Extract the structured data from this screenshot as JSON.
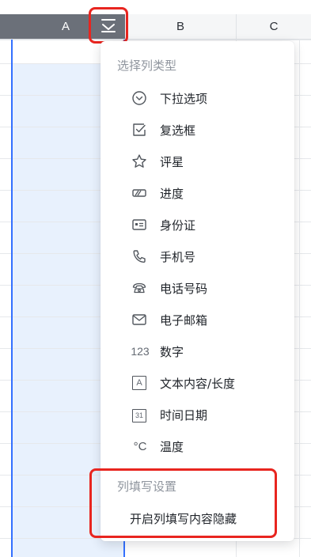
{
  "columns": {
    "a": "A",
    "b": "B",
    "c": "C"
  },
  "menu": {
    "title": "选择列类型",
    "items": [
      {
        "label": "下拉选项",
        "icon": "dropdown-circle-icon"
      },
      {
        "label": "复选框",
        "icon": "checkbox-icon"
      },
      {
        "label": "评星",
        "icon": "star-icon"
      },
      {
        "label": "进度",
        "icon": "progress-icon"
      },
      {
        "label": "身份证",
        "icon": "id-card-icon"
      },
      {
        "label": "手机号",
        "icon": "phone-icon"
      },
      {
        "label": "电话号码",
        "icon": "telephone-icon"
      },
      {
        "label": "电子邮箱",
        "icon": "mail-icon"
      },
      {
        "label": "数字",
        "icon": "number-icon",
        "icon_text": "123"
      },
      {
        "label": "文本内容/长度",
        "icon": "text-icon",
        "icon_text": "A"
      },
      {
        "label": "时间日期",
        "icon": "calendar-icon",
        "icon_text": "31"
      },
      {
        "label": "温度",
        "icon": "temperature-icon",
        "icon_text": "°C"
      }
    ],
    "settings_title": "列填写设置",
    "settings_item": "开启列填写内容隐藏"
  },
  "colors": {
    "selected_header": "#6b7079",
    "selection_border": "#3370ff",
    "selection_fill": "#e8f1fd",
    "highlight_red": "#e8251f"
  }
}
